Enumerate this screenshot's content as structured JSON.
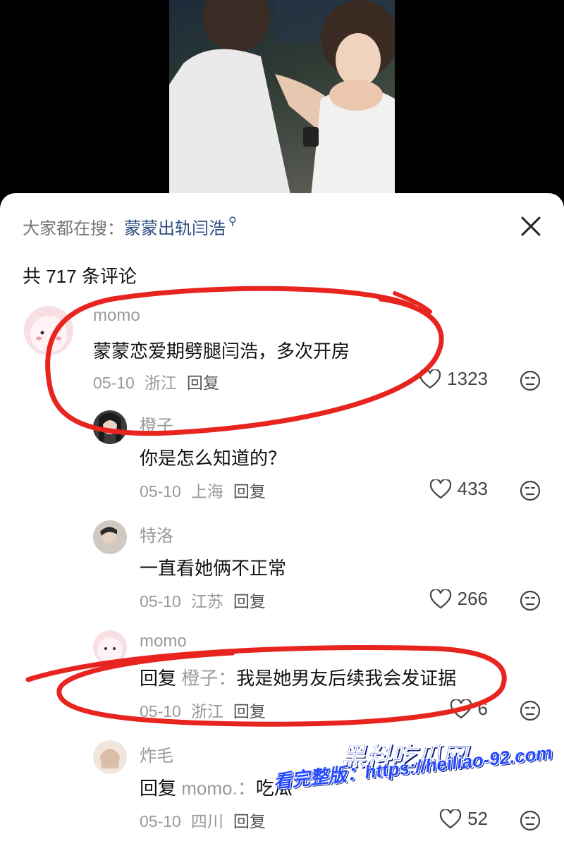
{
  "search": {
    "prefix": "大家都在搜：",
    "term": "蒙蒙出轨闫浩"
  },
  "comment_count": "共 717 条评论",
  "comments": [
    {
      "user": "momo",
      "text": "蒙蒙恋爱期劈腿闫浩，多次开房",
      "date": "05-10",
      "region": "浙江",
      "reply": "回复",
      "likes": "1323"
    },
    {
      "user": "橙子",
      "text": "你是怎么知道的？",
      "date": "05-10",
      "region": "上海",
      "reply": "回复",
      "likes": "433"
    },
    {
      "user": "特洛",
      "text": "一直看她俩不正常",
      "date": "05-10",
      "region": "江苏",
      "reply": "回复",
      "likes": "266"
    },
    {
      "user": "momo",
      "reply_prefix": "回复",
      "reply_to": "橙子：",
      "text": "我是她男友后续我会发证据",
      "date": "05-10",
      "region": "浙江",
      "reply": "回复",
      "likes": "6"
    },
    {
      "user": "炸毛",
      "reply_prefix": "回复",
      "reply_to": "momo.：",
      "text": "吃瓜",
      "date": "05-10",
      "region": "四川",
      "reply": "回复",
      "likes": "52"
    }
  ],
  "watermark": {
    "title": "黑料吃瓜网",
    "line": "看完整版：https://heiliao-92.com"
  },
  "colors": {
    "annotation_red": "#e8241f",
    "link_blue": "#2b4c7e",
    "watermark_blue": "#1f3fe0"
  },
  "icons": [
    "close-icon",
    "search-icon",
    "heart-icon",
    "face-icon"
  ]
}
